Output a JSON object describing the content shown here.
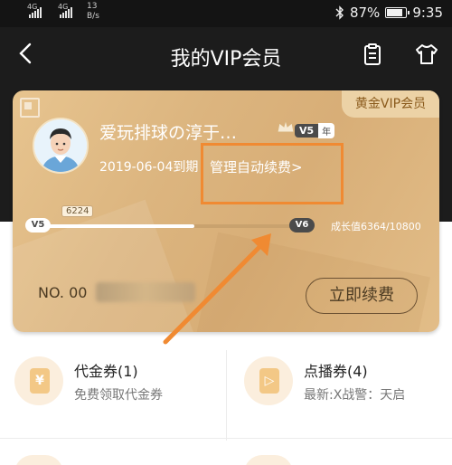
{
  "status_bar": {
    "signal_1": "4G",
    "signal_2": "4G",
    "net_speed_value": "13",
    "net_speed_unit": "B/s",
    "battery": "87%",
    "battery_level": 0.87,
    "time": "9:35"
  },
  "header": {
    "title": "我的VIP会员",
    "back_icon": "chevron-left-icon",
    "clipboard_icon": "clipboard-icon",
    "shirt_icon": "tshirt-icon"
  },
  "card": {
    "tier_tag": "黄金VIP会员",
    "username": "爱玩排球の淳于…",
    "level_badge": "V5",
    "level_badge_suffix": "年",
    "expire_text": "2019-06-04到期",
    "manage_link": "管理自动续费>",
    "progress_marker": "6224",
    "current_level": "V5",
    "next_level": "V6",
    "growth_text": "成长值6364/10800",
    "progress_fraction": 0.576,
    "card_number_label": "NO. 00",
    "renew_button": "立即续费"
  },
  "coupons": [
    {
      "icon": "yen-ticket-icon",
      "glyph": "¥",
      "title": "代金券(1)",
      "subtitle": "免费领取代金券"
    },
    {
      "icon": "play-ticket-icon",
      "glyph": "▷",
      "title": "点播券(4)",
      "subtitle": "最新:X战警：天启"
    }
  ],
  "colors": {
    "card_gold": "#dcb57f",
    "annotation_orange": "#f08a32",
    "header_bg": "#1c1c1c"
  }
}
